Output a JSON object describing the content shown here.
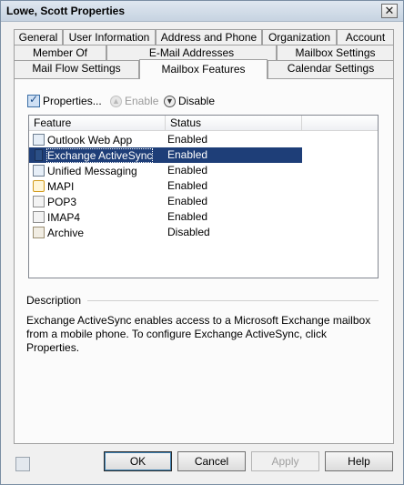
{
  "window": {
    "title": "Lowe, Scott Properties",
    "close_glyph": "✕"
  },
  "tabs": {
    "row1": [
      {
        "label": "General"
      },
      {
        "label": "User Information"
      },
      {
        "label": "Address and Phone"
      },
      {
        "label": "Organization"
      },
      {
        "label": "Account"
      }
    ],
    "row2": [
      {
        "label": "Member Of"
      },
      {
        "label": "E-Mail Addresses"
      },
      {
        "label": "Mailbox Settings"
      }
    ],
    "row3": [
      {
        "label": "Mail Flow Settings"
      },
      {
        "label": "Mailbox Features"
      },
      {
        "label": "Calendar Settings"
      }
    ],
    "active": "Mailbox Features"
  },
  "toolbar": {
    "properties_label": "Properties...",
    "enable_label": "Enable",
    "disable_label": "Disable"
  },
  "list": {
    "columns": [
      "Feature",
      "Status"
    ],
    "rows": [
      {
        "feature": "Outlook Web App",
        "status": "Enabled",
        "icon": "outlook-web-app-icon"
      },
      {
        "feature": "Exchange ActiveSync",
        "status": "Enabled",
        "icon": "mobile-device-icon",
        "selected": true
      },
      {
        "feature": "Unified Messaging",
        "status": "Enabled",
        "icon": "unified-messaging-icon"
      },
      {
        "feature": "MAPI",
        "status": "Enabled",
        "icon": "mapi-icon"
      },
      {
        "feature": "POP3",
        "status": "Enabled",
        "icon": "pop3-icon"
      },
      {
        "feature": "IMAP4",
        "status": "Enabled",
        "icon": "imap4-icon"
      },
      {
        "feature": "Archive",
        "status": "Disabled",
        "icon": "archive-icon"
      }
    ]
  },
  "description": {
    "label": "Description",
    "text": "Exchange ActiveSync enables access to a Microsoft Exchange mailbox from a mobile phone. To configure Exchange ActiveSync, click Properties."
  },
  "buttons": {
    "ok": "OK",
    "cancel": "Cancel",
    "apply": "Apply",
    "help": "Help"
  },
  "colors": {
    "selection": "#1e3e78",
    "panel_bg": "#fbfbfb",
    "window_bg": "#f0f0f0"
  }
}
